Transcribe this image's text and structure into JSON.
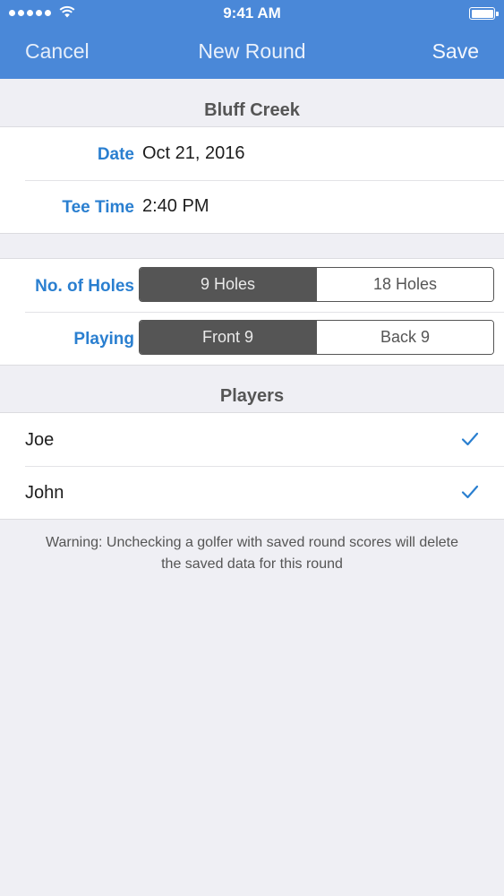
{
  "status": {
    "time": "9:41 AM"
  },
  "nav": {
    "cancel": "Cancel",
    "title": "New Round",
    "save": "Save"
  },
  "course": {
    "name": "Bluff Creek"
  },
  "details": {
    "date_label": "Date",
    "date_value": "Oct 21, 2016",
    "tee_label": "Tee Time",
    "tee_value": "2:40 PM"
  },
  "holes": {
    "label": "No. of Holes",
    "options": [
      "9 Holes",
      "18 Holes"
    ],
    "selected": "9 Holes"
  },
  "playing": {
    "label": "Playing",
    "options": [
      "Front 9",
      "Back 9"
    ],
    "selected": "Front 9"
  },
  "players": {
    "header": "Players",
    "list": [
      {
        "name": "Joe",
        "checked": true
      },
      {
        "name": "John",
        "checked": true
      }
    ]
  },
  "warning": "Warning: Unchecking a golfer with saved round scores will delete the saved data for this round",
  "colors": {
    "accent": "#4a88d8",
    "label": "#2a7fd0",
    "segment": "#555555"
  }
}
